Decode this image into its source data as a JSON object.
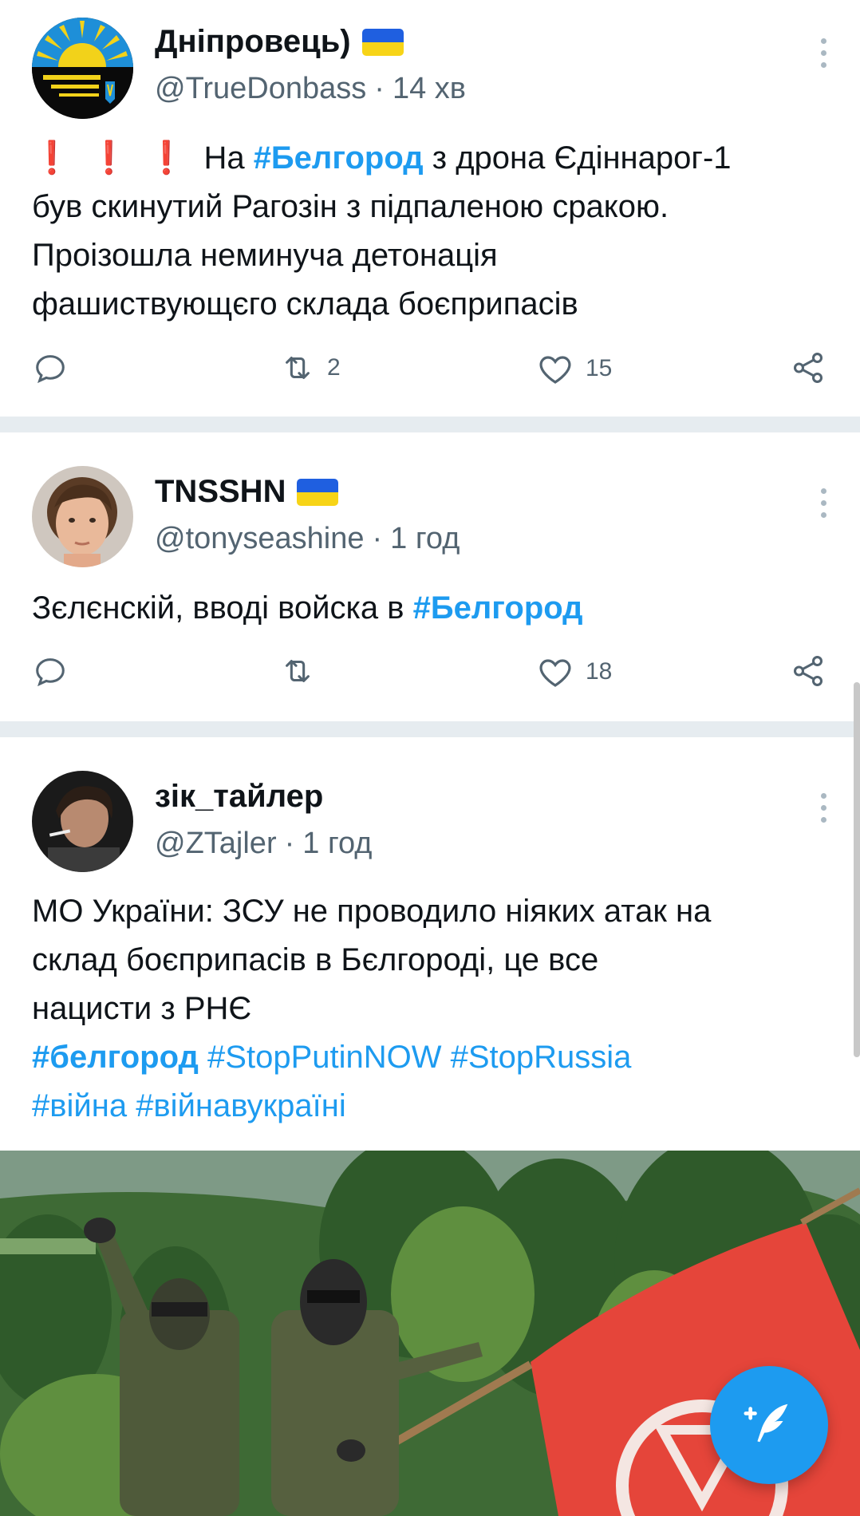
{
  "tweets": [
    {
      "name": "Дніпровець)",
      "handle": "@TrueDonbass",
      "dot": "·",
      "time": "14 хв",
      "text_lines": {
        "excl": [
          "❗",
          "❗",
          "❗"
        ],
        "l1_pre": "На ",
        "l1_tag": "#Белгород",
        "l1_post": " з дрона Єдіннарог-1",
        "l2": "був скинутий Рагозін з підпаленою сракою.",
        "l3": "Проізошла неминуча детонація",
        "l4": "фашиствующєго склада боєприпасів"
      },
      "retweets": "2",
      "likes": "15"
    },
    {
      "name": "TNSSHN",
      "handle": "@tonyseashine",
      "dot": "·",
      "time": "1 год",
      "text_pre": "Зєлєнскій, вводі войска в ",
      "text_tag": "#Белгород",
      "retweets": "",
      "likes": "18"
    },
    {
      "name": "зік_тайлер",
      "handle": "@ZTajler",
      "dot": "·",
      "time": "1 год",
      "l1": "МО України: ЗСУ не проводило ніяких атак на",
      "l2": "склад боєприпасів в Бєлгороді, це все",
      "l3": "нацисти з РНЄ",
      "tags_l4": [
        "#белгород",
        "#StopPutinNOW",
        "#StopRussia"
      ],
      "tags_l5": [
        "#війна",
        "#війнавукраїні"
      ]
    }
  ],
  "icons": {
    "reply": "reply-icon",
    "retweet": "retweet-icon",
    "like": "heart-icon",
    "share": "share-icon",
    "compose": "compose-tweet-icon"
  },
  "colors": {
    "accent": "#1d9bf0",
    "text": "#0f1419",
    "secondary": "#536471",
    "separator": "#e6ecf0"
  }
}
